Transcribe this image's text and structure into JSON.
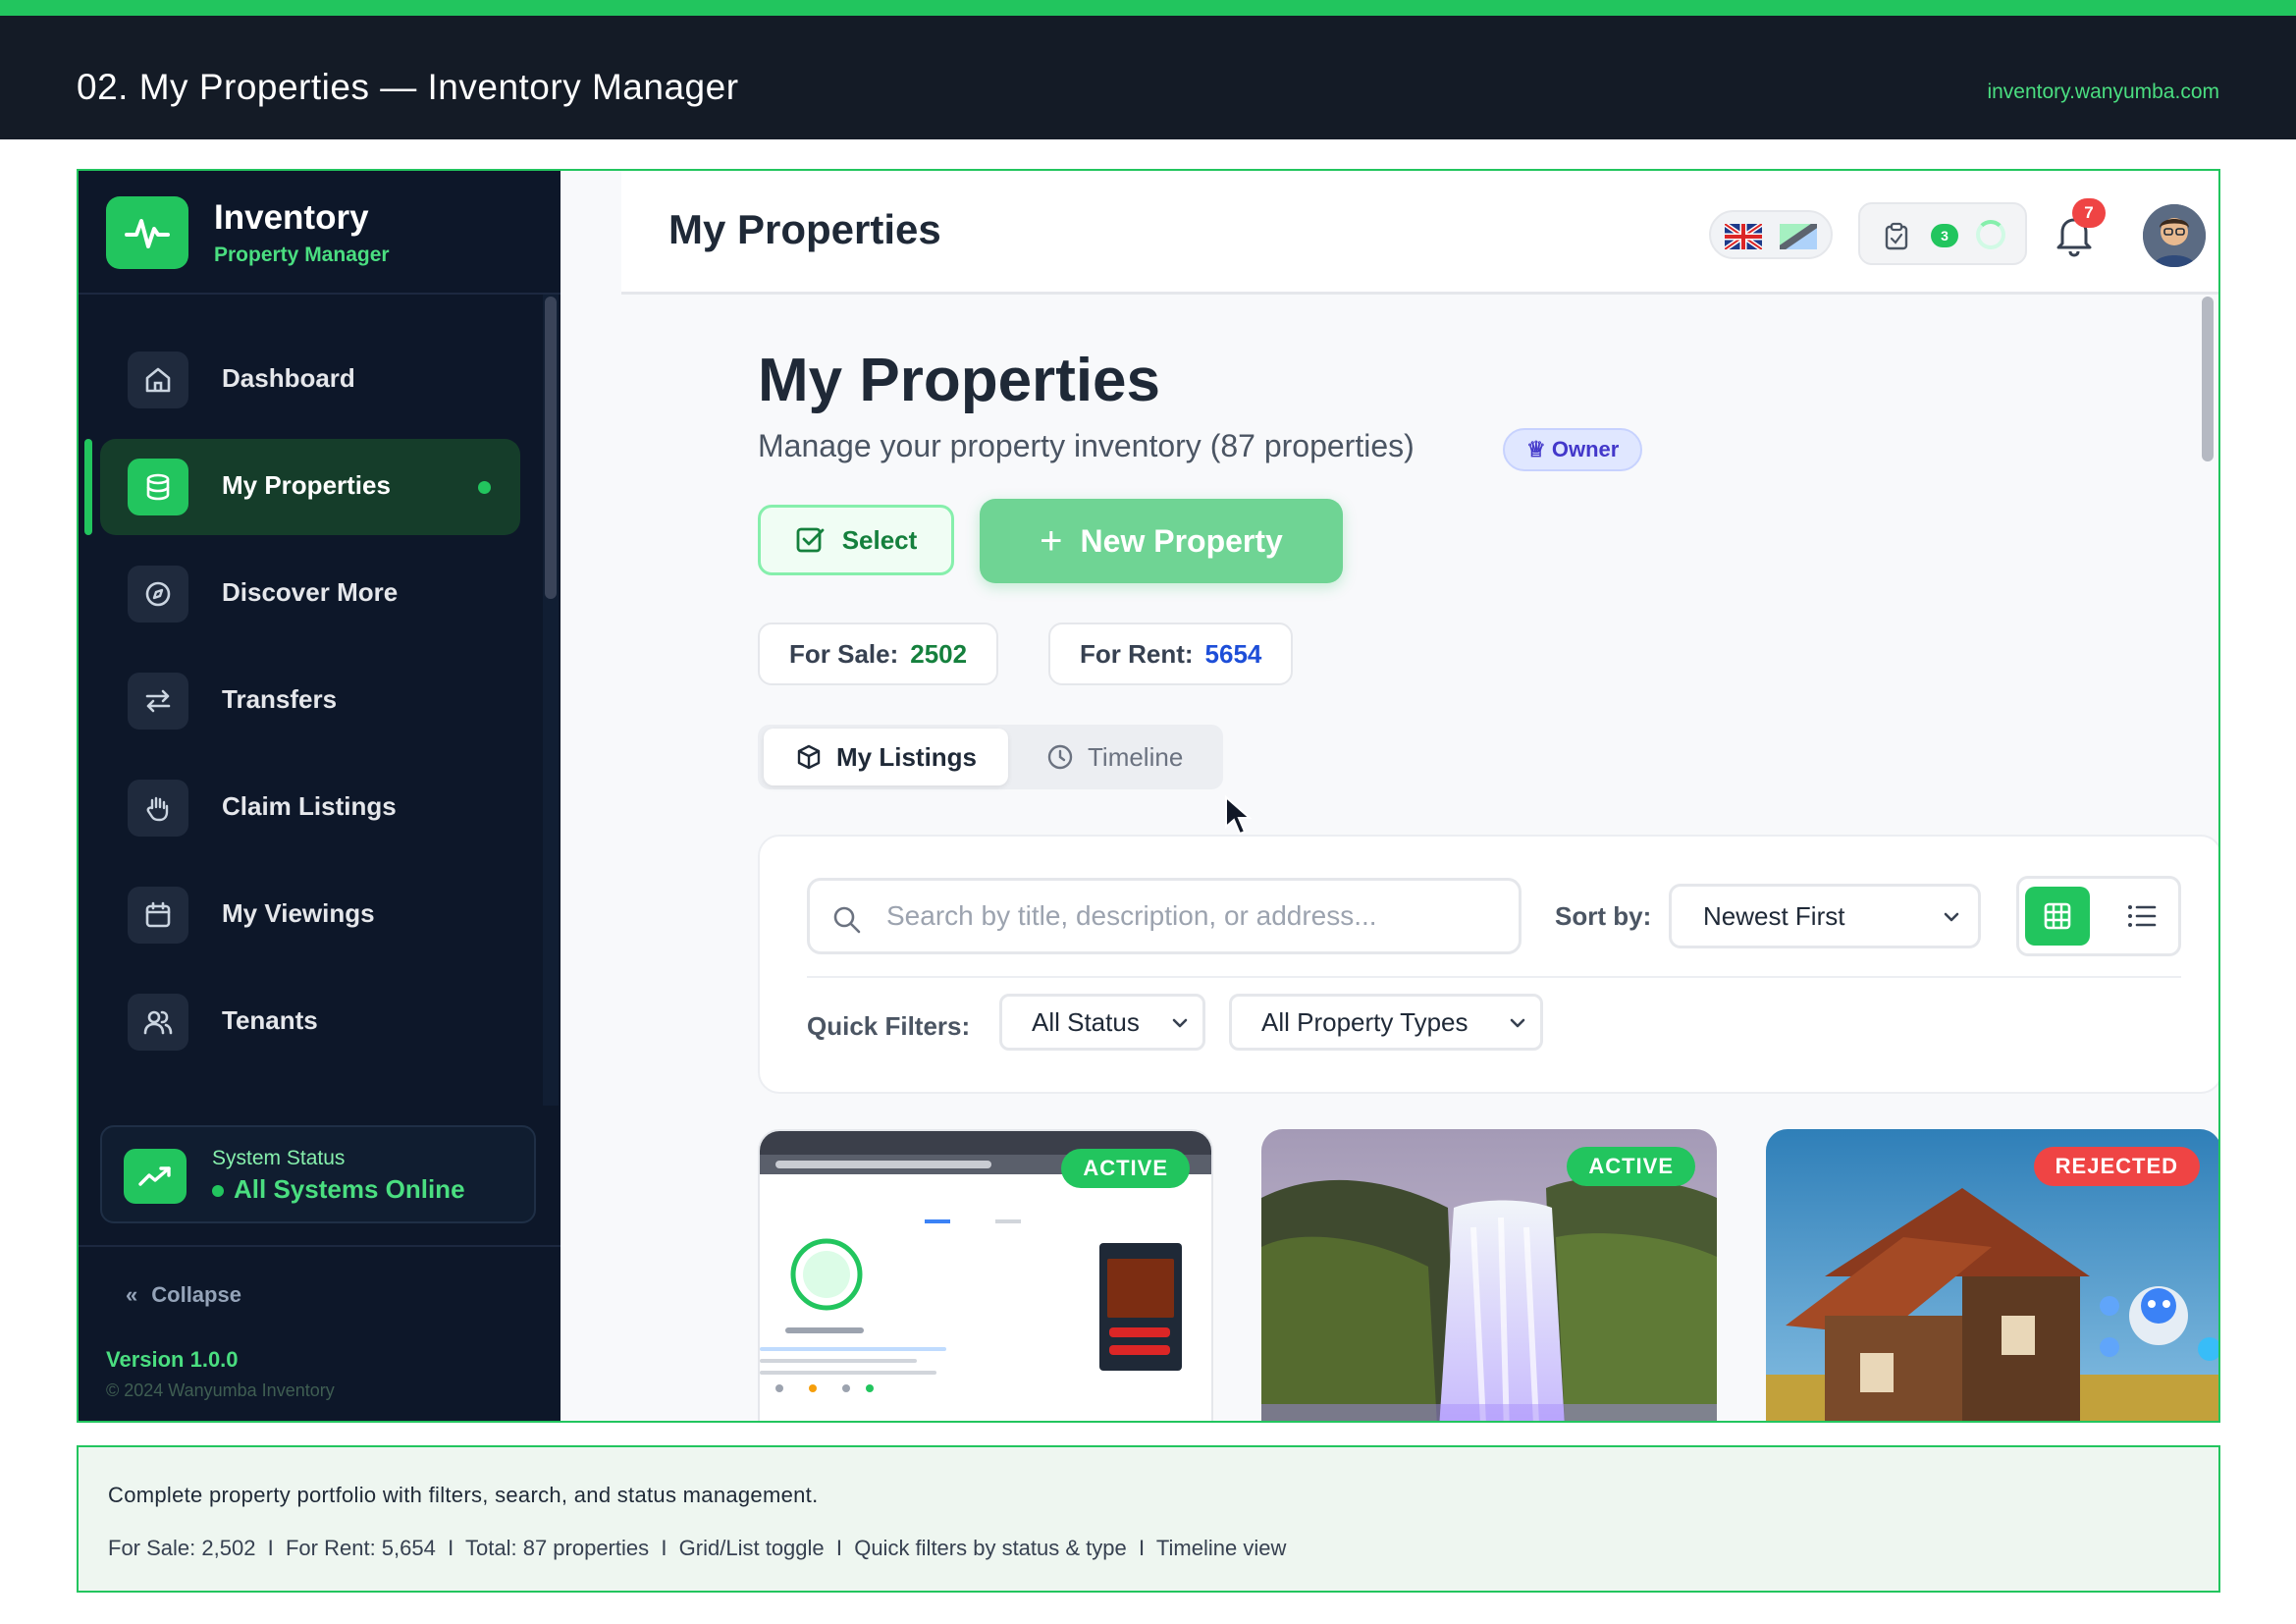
{
  "doc": {
    "title": "02. My Properties — Inventory Manager",
    "url": "inventory.wanyumba.com"
  },
  "brand": {
    "name": "Inventory",
    "subtitle": "Property Manager",
    "logo_icon": "pulse-icon"
  },
  "sidebar": {
    "items": [
      {
        "label": "Dashboard",
        "icon": "home-icon",
        "active": false
      },
      {
        "label": "My Properties",
        "icon": "database-icon",
        "active": true
      },
      {
        "label": "Discover More",
        "icon": "compass-icon",
        "active": false
      },
      {
        "label": "Transfers",
        "icon": "arrows-swap-icon",
        "active": false
      },
      {
        "label": "Claim Listings",
        "icon": "hand-icon",
        "active": false
      },
      {
        "label": "My Viewings",
        "icon": "calendar-icon",
        "active": false
      },
      {
        "label": "Tenants",
        "icon": "users-icon",
        "active": false
      }
    ],
    "status_label": "System Status",
    "status_value": "All Systems Online",
    "collapse_label": "Collapse",
    "version": "Version 1.0.0",
    "copyright": "© 2024 Wanyumba Inventory"
  },
  "appbar": {
    "title": "My Properties",
    "task_count": "3",
    "notification_count": "7"
  },
  "page": {
    "heading": "My Properties",
    "subtitle": "Manage your property inventory (87 properties)",
    "role_badge": "Owner",
    "select_label": "Select",
    "new_property_label": "New Property",
    "for_sale_label": "For Sale:",
    "for_sale_value": "2502",
    "for_rent_label": "For Rent:",
    "for_rent_value": "5654",
    "tabs": [
      {
        "label": "My Listings",
        "active": true
      },
      {
        "label": "Timeline",
        "active": false
      }
    ]
  },
  "filters": {
    "search_placeholder": "Search by title, description, or address...",
    "sort_label": "Sort by:",
    "sort_value": "Newest First",
    "quick_filters_label": "Quick Filters:",
    "status_value": "All Status",
    "type_value": "All Property Types",
    "view_mode": "grid"
  },
  "cards": [
    {
      "badge": "ACTIVE",
      "status": "active"
    },
    {
      "badge": "ACTIVE",
      "status": "active"
    },
    {
      "badge": "REJECTED",
      "status": "rejected"
    }
  ],
  "caption": {
    "line1": "Complete property portfolio with filters, search, and status management.",
    "line2": "For Sale: 2,502  I  For Rent: 5,654  I  Total: 87 properties  I  Grid/List toggle  I  Quick filters by status & type  I  Timeline view"
  },
  "colors": {
    "accent": "#22c55e",
    "sidebar_bg": "#0d1729",
    "header_bg": "#141b26",
    "rejected": "#ef4444"
  }
}
